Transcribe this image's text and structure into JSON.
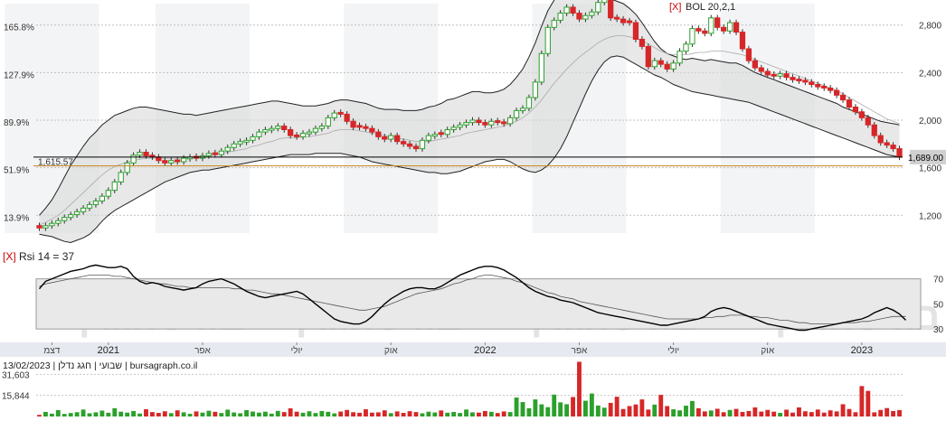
{
  "chart_data": {
    "type": "candlestick",
    "indicator_label": "BOL 20,2,1",
    "indicator_close_glyph": "[X]",
    "price_axis_right": [
      "2,800",
      "2,400",
      "2,000",
      "1,600",
      "1,200"
    ],
    "price_axis_right_values": [
      2800,
      2400,
      2000,
      1600,
      1200
    ],
    "pct_axis_left": [
      "165.8%",
      "127.9%",
      "89.9%",
      "51.9%",
      "13.9%"
    ],
    "current_price_label": "1,689.00",
    "current_price": 1689,
    "reference_label": "1,615.57",
    "reference_price": 1615.57,
    "price_range": [
      1050,
      2980
    ],
    "x_labels": [
      "דצמ",
      "2021",
      "אפר",
      "יולי",
      "אוק",
      "2022",
      "אפר",
      "יולי",
      "אוק",
      "2023"
    ],
    "x_label_emphasis": [
      false,
      true,
      false,
      false,
      false,
      true,
      false,
      false,
      false,
      true
    ],
    "x_label_index": [
      2,
      11,
      26,
      41,
      56,
      71,
      86,
      101,
      116,
      131
    ],
    "n_bars": 138,
    "candles": {
      "close": [
        1093,
        1112,
        1132,
        1155,
        1182,
        1205,
        1230,
        1260,
        1290,
        1320,
        1360,
        1410,
        1480,
        1560,
        1640,
        1705,
        1730,
        1700,
        1690,
        1660,
        1640,
        1660,
        1650,
        1680,
        1690,
        1680,
        1700,
        1720,
        1710,
        1740,
        1770,
        1800,
        1820,
        1830,
        1860,
        1900,
        1920,
        1930,
        1950,
        1920,
        1870,
        1860,
        1890,
        1900,
        1930,
        1950,
        2020,
        2060,
        2050,
        1990,
        1940,
        1940,
        1930,
        1900,
        1860,
        1840,
        1870,
        1820,
        1800,
        1780,
        1760,
        1830,
        1870,
        1880,
        1880,
        1920,
        1940,
        1960,
        1980,
        2000,
        1980,
        1960,
        1990,
        1980,
        1970,
        2020,
        2080,
        2100,
        2190,
        2320,
        2560,
        2780,
        2840,
        2900,
        2950,
        2900,
        2850,
        2880,
        2910,
        2990,
        3020,
        2860,
        2850,
        2820,
        2820,
        2680,
        2620,
        2450,
        2500,
        2470,
        2430,
        2480,
        2580,
        2640,
        2770,
        2750,
        2730,
        2860,
        2780,
        2750,
        2820,
        2740,
        2600,
        2500,
        2440,
        2410,
        2380,
        2370,
        2390,
        2360,
        2340,
        2330,
        2320,
        2300,
        2280,
        2270,
        2250,
        2210,
        2170,
        2110,
        2070,
        2020,
        1960,
        1870,
        1810,
        1790,
        1760,
        1689
      ],
      "direction": [
        "down",
        "up",
        "up",
        "up",
        "up",
        "up",
        "up",
        "up",
        "up",
        "up",
        "up",
        "up",
        "up",
        "up",
        "up",
        "up",
        "up",
        "down",
        "down",
        "down",
        "down",
        "up",
        "down",
        "up",
        "up",
        "down",
        "up",
        "up",
        "down",
        "up",
        "up",
        "up",
        "up",
        "up",
        "up",
        "up",
        "up",
        "up",
        "up",
        "down",
        "down",
        "down",
        "up",
        "up",
        "up",
        "up",
        "up",
        "up",
        "down",
        "down",
        "down",
        "down",
        "down",
        "down",
        "down",
        "down",
        "up",
        "down",
        "down",
        "down",
        "down",
        "up",
        "up",
        "up",
        "down",
        "up",
        "up",
        "up",
        "up",
        "up",
        "down",
        "down",
        "up",
        "down",
        "down",
        "up",
        "up",
        "up",
        "up",
        "up",
        "up",
        "up",
        "up",
        "up",
        "up",
        "down",
        "down",
        "up",
        "up",
        "up",
        "up",
        "down",
        "down",
        "down",
        "down",
        "down",
        "down",
        "down",
        "up",
        "down",
        "down",
        "up",
        "up",
        "up",
        "up",
        "down",
        "down",
        "up",
        "down",
        "down",
        "up",
        "down",
        "down",
        "down",
        "down",
        "down",
        "down",
        "down",
        "up",
        "down",
        "down",
        "down",
        "down",
        "down",
        "down",
        "down",
        "down",
        "down",
        "down",
        "down",
        "down",
        "down",
        "down",
        "down",
        "down",
        "down",
        "down",
        "down"
      ]
    },
    "bollinger": {
      "upper": [
        1200,
        1260,
        1330,
        1420,
        1520,
        1620,
        1700,
        1780,
        1850,
        1900,
        1960,
        2000,
        2040,
        2060,
        2080,
        2100,
        2110,
        2110,
        2100,
        2090,
        2080,
        2070,
        2060,
        2050,
        2050,
        2040,
        2050,
        2060,
        2070,
        2080,
        2090,
        2100,
        2110,
        2120,
        2130,
        2140,
        2150,
        2160,
        2160,
        2150,
        2140,
        2130,
        2120,
        2120,
        2120,
        2130,
        2140,
        2160,
        2170,
        2170,
        2160,
        2150,
        2140,
        2120,
        2100,
        2090,
        2090,
        2090,
        2080,
        2080,
        2080,
        2090,
        2110,
        2120,
        2140,
        2170,
        2180,
        2200,
        2220,
        2240,
        2240,
        2230,
        2230,
        2240,
        2260,
        2300,
        2360,
        2430,
        2530,
        2650,
        2790,
        2920,
        3010,
        3060,
        3080,
        3080,
        3080,
        3070,
        3060,
        3060,
        3040,
        3020,
        3000,
        2980,
        2940,
        2890,
        2820,
        2740,
        2660,
        2600,
        2560,
        2540,
        2520,
        2510,
        2520,
        2510,
        2500,
        2510,
        2500,
        2490,
        2480,
        2480,
        2460,
        2430,
        2400,
        2380,
        2360,
        2340,
        2320,
        2300,
        2280,
        2260,
        2240,
        2220,
        2200,
        2180,
        2160,
        2140,
        2110,
        2090,
        2070,
        2050,
        2030,
        2010,
        1990,
        1980,
        1970,
        1960
      ],
      "middle": [
        1120,
        1140,
        1170,
        1200,
        1240,
        1290,
        1340,
        1390,
        1440,
        1490,
        1540,
        1580,
        1610,
        1630,
        1650,
        1660,
        1670,
        1680,
        1680,
        1680,
        1680,
        1680,
        1680,
        1680,
        1690,
        1690,
        1700,
        1700,
        1710,
        1720,
        1730,
        1740,
        1750,
        1760,
        1780,
        1790,
        1810,
        1820,
        1840,
        1850,
        1850,
        1850,
        1860,
        1860,
        1870,
        1880,
        1890,
        1910,
        1920,
        1920,
        1920,
        1910,
        1900,
        1890,
        1880,
        1870,
        1860,
        1850,
        1840,
        1830,
        1820,
        1820,
        1820,
        1830,
        1840,
        1850,
        1860,
        1870,
        1890,
        1900,
        1910,
        1920,
        1930,
        1940,
        1950,
        1970,
        1990,
        2020,
        2060,
        2110,
        2170,
        2240,
        2310,
        2370,
        2430,
        2480,
        2530,
        2570,
        2610,
        2650,
        2680,
        2700,
        2710,
        2710,
        2700,
        2690,
        2670,
        2640,
        2610,
        2580,
        2560,
        2550,
        2550,
        2550,
        2560,
        2570,
        2570,
        2580,
        2580,
        2580,
        2570,
        2560,
        2550,
        2530,
        2510,
        2490,
        2470,
        2450,
        2430,
        2410,
        2390,
        2370,
        2350,
        2330,
        2310,
        2290,
        2270,
        2250,
        2220,
        2190,
        2160,
        2130,
        2100,
        2070,
        2040,
        2010,
        1990,
        1970
      ],
      "lower": [
        1040,
        1030,
        1020,
        1000,
        980,
        970,
        990,
        1010,
        1040,
        1090,
        1150,
        1200,
        1240,
        1270,
        1300,
        1330,
        1360,
        1390,
        1420,
        1450,
        1480,
        1500,
        1520,
        1540,
        1560,
        1570,
        1580,
        1580,
        1590,
        1600,
        1610,
        1620,
        1630,
        1640,
        1650,
        1660,
        1670,
        1680,
        1690,
        1700,
        1710,
        1710,
        1710,
        1710,
        1720,
        1720,
        1720,
        1720,
        1720,
        1710,
        1700,
        1690,
        1670,
        1650,
        1640,
        1630,
        1620,
        1610,
        1600,
        1590,
        1580,
        1570,
        1560,
        1560,
        1550,
        1550,
        1560,
        1570,
        1590,
        1610,
        1630,
        1650,
        1660,
        1670,
        1670,
        1650,
        1620,
        1590,
        1570,
        1560,
        1580,
        1620,
        1680,
        1760,
        1860,
        1980,
        2100,
        2220,
        2330,
        2420,
        2490,
        2530,
        2540,
        2530,
        2500,
        2470,
        2440,
        2410,
        2380,
        2360,
        2330,
        2300,
        2280,
        2260,
        2240,
        2230,
        2220,
        2210,
        2200,
        2190,
        2180,
        2170,
        2160,
        2150,
        2130,
        2110,
        2090,
        2070,
        2050,
        2030,
        2010,
        1990,
        1970,
        1950,
        1930,
        1910,
        1890,
        1870,
        1850,
        1830,
        1810,
        1790,
        1770,
        1750,
        1730,
        1710,
        1700,
        1690
      ]
    },
    "rsi": {
      "label_close": "[X]",
      "label": "Rsi 14 = 37",
      "ticks": [
        "70",
        "50",
        "30"
      ],
      "tick_values": [
        70,
        50,
        30
      ],
      "band": [
        30,
        70
      ],
      "range": [
        20,
        82
      ],
      "values": [
        62,
        68,
        70,
        72,
        74,
        76,
        77,
        78,
        80,
        81,
        80,
        79,
        79,
        80,
        78,
        72,
        68,
        66,
        67,
        66,
        64,
        63,
        62,
        61,
        62,
        63,
        66,
        68,
        69,
        70,
        68,
        66,
        63,
        60,
        58,
        56,
        55,
        56,
        57,
        58,
        59,
        60,
        58,
        54,
        50,
        46,
        42,
        38,
        36,
        35,
        34,
        34,
        36,
        40,
        45,
        50,
        54,
        57,
        60,
        62,
        63,
        63,
        62,
        62,
        64,
        67,
        70,
        73,
        75,
        77,
        79,
        80,
        80,
        79,
        77,
        74,
        71,
        67,
        63,
        60,
        58,
        56,
        55,
        53,
        52,
        51,
        49,
        47,
        45,
        43,
        42,
        41,
        40,
        39,
        38,
        37,
        36,
        35,
        34,
        33,
        33,
        34,
        35,
        36,
        37,
        38,
        40,
        44,
        46,
        47,
        46,
        44,
        42,
        40,
        38,
        36,
        34,
        33,
        32,
        31,
        30,
        29,
        29,
        30,
        31,
        32,
        33,
        34,
        35,
        36,
        37,
        38,
        40,
        43,
        45,
        47,
        45,
        42,
        37
      ],
      "signal": [
        64,
        66,
        67,
        68,
        69,
        70,
        71,
        72,
        73,
        73,
        73,
        73,
        72,
        72,
        71,
        70,
        69,
        68,
        67,
        66,
        66,
        65,
        64,
        64,
        63,
        63,
        63,
        63,
        63,
        63,
        63,
        62,
        62,
        61,
        61,
        60,
        59,
        58,
        58,
        57,
        56,
        55,
        54,
        53,
        52,
        51,
        50,
        49,
        48,
        47,
        46,
        45,
        45,
        46,
        47,
        48,
        50,
        52,
        54,
        56,
        58,
        59,
        60,
        61,
        62,
        64,
        66,
        67,
        69,
        70,
        72,
        73,
        73,
        72,
        71,
        70,
        68,
        67,
        65,
        63,
        61,
        59,
        58,
        56,
        55,
        54,
        52,
        51,
        50,
        49,
        48,
        47,
        46,
        45,
        44,
        43,
        42,
        41,
        40,
        39,
        38,
        38,
        38,
        38,
        38,
        38,
        39,
        39,
        40,
        40,
        41,
        41,
        41,
        40,
        40,
        39,
        39,
        38,
        37,
        37,
        36,
        35,
        35,
        34,
        34,
        34,
        34,
        34,
        35,
        35,
        35,
        36,
        36,
        37,
        38,
        39,
        40,
        40,
        40
      ]
    },
    "volume": {
      "ticks": [
        "31,603",
        "15,844"
      ],
      "tick_values": [
        31603,
        15844
      ],
      "max": 42000,
      "values": [
        1200,
        3400,
        2100,
        4800,
        1900,
        2600,
        3200,
        5200,
        2400,
        3100,
        4400,
        2800,
        6200,
        3600,
        2900,
        4100,
        2200,
        5400,
        3300,
        2700,
        3900,
        2500,
        4600,
        3100,
        2000,
        3800,
        2900,
        4300,
        3500,
        2600,
        5100,
        3000,
        2400,
        4800,
        3700,
        2900,
        3600,
        2100,
        4200,
        3300,
        6100,
        3600,
        2800,
        3900,
        2600,
        4100,
        3500,
        2300,
        3700,
        4900,
        3200,
        2800,
        5400,
        2900,
        3100,
        4600,
        2500,
        3800,
        2700,
        4000,
        3300,
        2400,
        3600,
        3000,
        4500,
        2800,
        3400,
        2600,
        5200,
        3100,
        2900,
        4100,
        3500,
        2600,
        3800,
        3300,
        14200,
        10800,
        6200,
        12800,
        9100,
        7000,
        16400,
        10600,
        9200,
        14600,
        41000,
        11800,
        17200,
        8200,
        6600,
        10200,
        14800,
        5600,
        7800,
        9000,
        12800,
        5200,
        8900,
        16200,
        7800,
        5400,
        4600,
        8100,
        11600,
        6200,
        3800,
        4500,
        5800,
        3200,
        4900,
        5700,
        3400,
        4100,
        6800,
        3700,
        4900,
        3600,
        2700,
        5100,
        2900,
        6800,
        3900,
        3300,
        5200,
        2900,
        4600,
        3800,
        9200,
        5600,
        3200,
        22800,
        19200,
        3100,
        4900,
        6300,
        4100,
        4800
      ],
      "direction": [
        "down",
        "up",
        "up",
        "up",
        "up",
        "up",
        "up",
        "up",
        "up",
        "up",
        "up",
        "up",
        "up",
        "up",
        "up",
        "up",
        "up",
        "down",
        "down",
        "down",
        "down",
        "up",
        "down",
        "up",
        "up",
        "down",
        "up",
        "up",
        "down",
        "up",
        "up",
        "up",
        "up",
        "up",
        "up",
        "up",
        "up",
        "up",
        "up",
        "down",
        "down",
        "down",
        "up",
        "up",
        "up",
        "up",
        "up",
        "up",
        "down",
        "down",
        "down",
        "down",
        "down",
        "down",
        "down",
        "down",
        "up",
        "down",
        "down",
        "down",
        "down",
        "up",
        "up",
        "up",
        "down",
        "up",
        "up",
        "up",
        "up",
        "up",
        "down",
        "down",
        "up",
        "down",
        "down",
        "up",
        "up",
        "up",
        "up",
        "up",
        "up",
        "up",
        "up",
        "up",
        "up",
        "down",
        "down",
        "up",
        "up",
        "up",
        "up",
        "down",
        "down",
        "down",
        "down",
        "down",
        "down",
        "down",
        "up",
        "down",
        "down",
        "up",
        "up",
        "up",
        "up",
        "down",
        "down",
        "up",
        "down",
        "down",
        "up",
        "down",
        "down",
        "down",
        "down",
        "down",
        "down",
        "down",
        "up",
        "down",
        "down",
        "down",
        "down",
        "down",
        "down",
        "down",
        "down",
        "down",
        "down",
        "down",
        "down",
        "down",
        "down",
        "down",
        "down",
        "down",
        "down",
        "down"
      ]
    },
    "footer_info": "שבועי | חגג נדלן | 13/02/2023 | bursagraph.co.il",
    "watermark": [
      "בורסהגרף",
      "בורסהגרף",
      "בורסהגרף",
      "בורסהגרף"
    ],
    "colors": {
      "up": "#2ca02c",
      "down": "#d62728",
      "band": "#d9d9d9",
      "axis_bg": "#e6e9ef",
      "reference": "#c8821e"
    }
  }
}
